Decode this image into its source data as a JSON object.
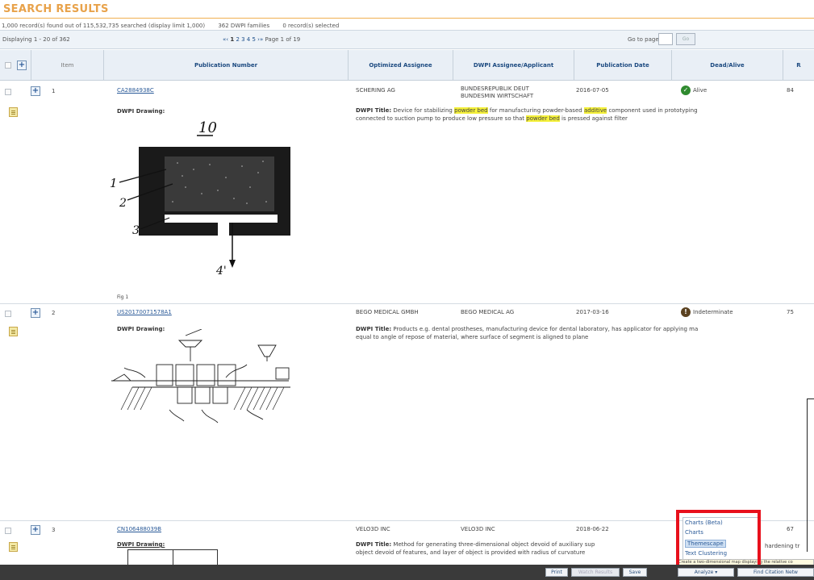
{
  "header": {
    "title": "SEARCH RESULTS",
    "records_found": "1,000 record(s) found out of 115,532,735 searched (display limit 1,000)",
    "families": "362 DWPI families",
    "selected": "0 record(s) selected"
  },
  "pager": {
    "displaying": "Displaying 1 - 20 of 362",
    "nav_prefix": "«‹",
    "current_page_link": "1",
    "page_links": "2 3 4 5",
    "nav_suffix": "›»",
    "page_label": "Page 1 of 19",
    "goto_label": "Go to page:",
    "goto_value": "",
    "goto_button": "Go"
  },
  "columns": {
    "item": "Item",
    "publication_number": "Publication Number",
    "optimized_assignee": "Optimized Assignee",
    "dwpi_assignee": "DWPI Assignee/Applicant",
    "publication_date": "Publication Date",
    "dead_alive": "Dead/Alive",
    "last_truncated": "R"
  },
  "rows": [
    {
      "item": "1",
      "publication_number": "CA2884938C",
      "optimized_assignee": "SCHERING AG",
      "dwpi_assignee_line1": "BUNDESREPUBLIK DEUT",
      "dwpi_assignee_line2": "BUNDESMIN WIRTSCHAFT",
      "publication_date": "2016-07-05",
      "status": "Alive",
      "status_color": "#2f8a2f",
      "score": "84",
      "drawing_label": "DWPI Drawing:",
      "fig_caption": "Fig 1",
      "title_label": "DWPI Title:",
      "title_a": "Device for stabilizing",
      "title_hl1": "powder bed",
      "title_b": "for manufacturing powder-based",
      "title_hl2": "additive",
      "title_c": "component used in prototyping",
      "title_line2_a": "connected to suction pump to produce low pressure so that",
      "title_hl3": "powder bed",
      "title_line2_b": "is pressed against filter",
      "fig_labels": {
        "top": "10",
        "l1": "1",
        "l2": "2",
        "l3": "3",
        "l4": "4'"
      }
    },
    {
      "item": "2",
      "publication_number": "US20170071578A1",
      "optimized_assignee": "BEGO MEDICAL GMBH",
      "dwpi_assignee_line1": "BEGO MEDICAL AG",
      "publication_date": "2017-03-16",
      "status": "Indeterminate",
      "status_color": "#5b4220",
      "score": "75",
      "drawing_label": "DWPI Drawing:",
      "title_label": "DWPI Title:",
      "title_line1": "Products e.g. dental prostheses, manufacturing device for dental laboratory, has applicator for applying ma",
      "title_line2": "equal to angle of repose of material, where surface of segment is aligned to plane"
    },
    {
      "item": "3",
      "publication_number": "CN106488039B",
      "optimized_assignee": "VELO3D INC",
      "dwpi_assignee_line1": "VELO3D INC",
      "publication_date": "2018-06-22",
      "score": "67",
      "drawing_label": "DWPI Drawing:",
      "title_label": "DWPI Title:",
      "title_line1": "Method for generating three-dimensional object devoid of auxiliary sup",
      "title_line1_tail": "hardening tr",
      "title_line2": "object devoid of features, and layer of object is provided with radius of curvature"
    }
  ],
  "context_menu": {
    "items": [
      "Charts (Beta)",
      "Charts",
      "Themescape",
      "Text Clustering"
    ],
    "active_index": 2,
    "tooltip": "Create a two-dimensional map displaying the relative co"
  },
  "bottom_toolbar": {
    "print": "Print",
    "watch_results": "Watch Results",
    "save": "Save",
    "analyze": "Analyze ▾",
    "more": "Find Citation Netw"
  },
  "colors": {
    "title_orange": "#e8a24a",
    "link_blue": "#2a5a98",
    "highlight_yellow": "#f4f03a",
    "annotation_red": "#e8101c"
  }
}
